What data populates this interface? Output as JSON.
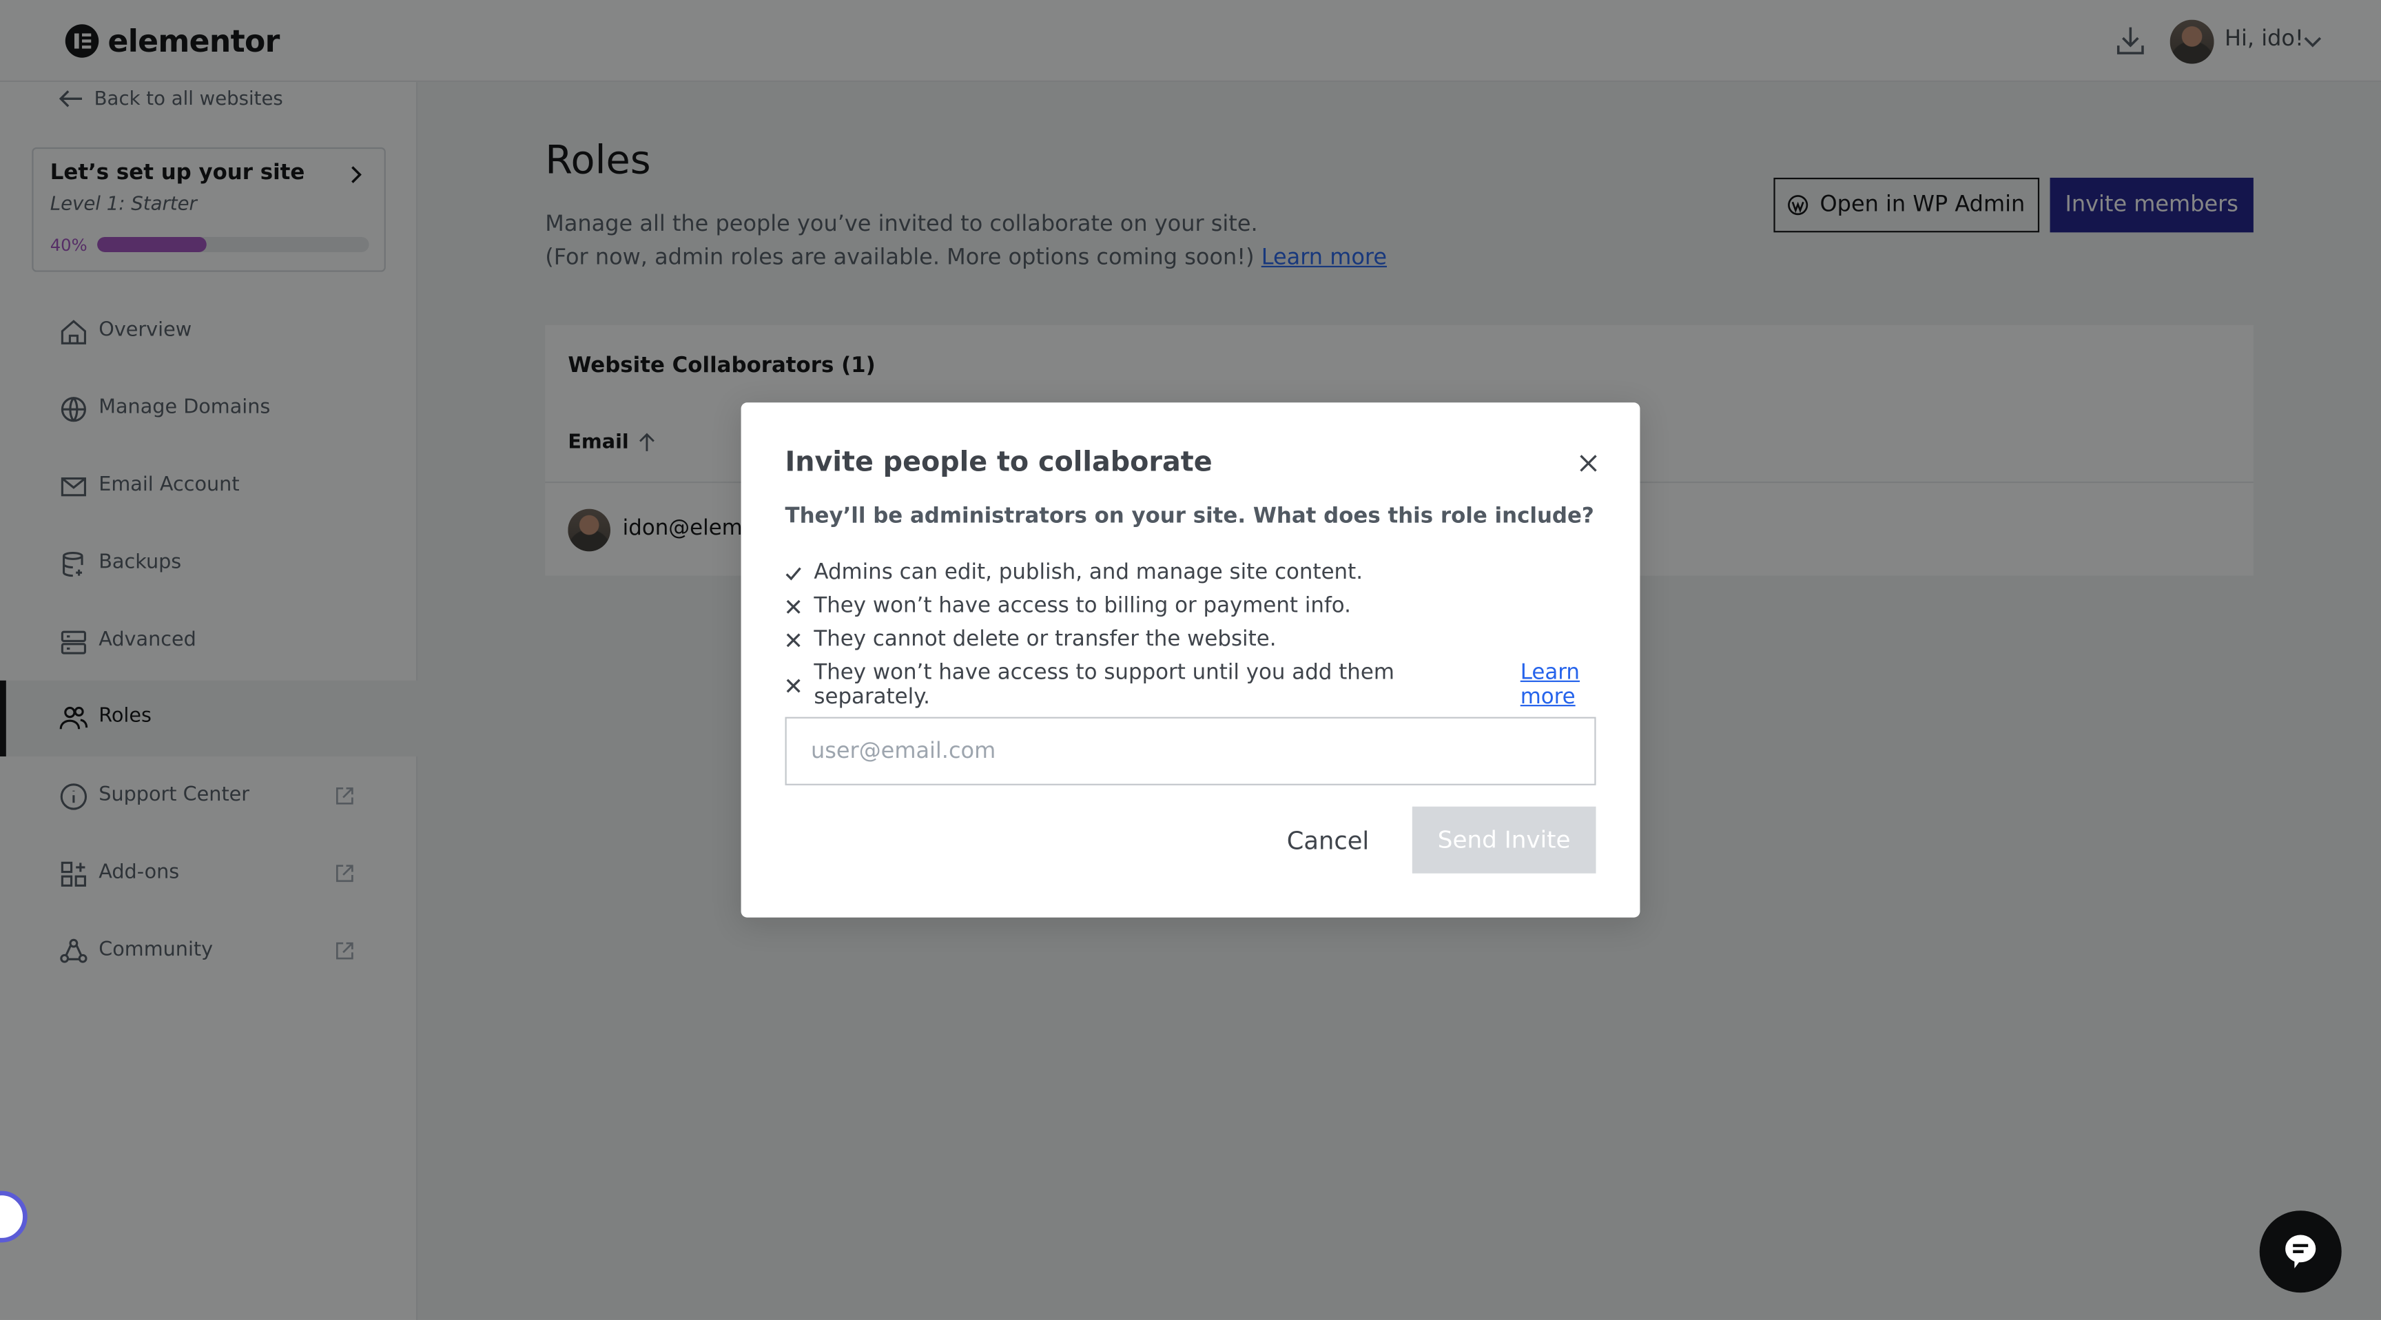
{
  "header": {
    "logo_text": "elementor",
    "greeting": "Hi, ido!"
  },
  "sidebar": {
    "back_label": "Back to all websites",
    "setup": {
      "title": "Let’s set up your site",
      "level": "Level 1: Starter",
      "progress_label": "40%",
      "progress_fraction": 0.4
    },
    "items": [
      {
        "label": "Overview",
        "icon": "home-icon",
        "external": false,
        "active": false
      },
      {
        "label": "Manage Domains",
        "icon": "globe-icon",
        "external": false,
        "active": false
      },
      {
        "label": "Email Account",
        "icon": "mail-icon",
        "external": false,
        "active": false
      },
      {
        "label": "Backups",
        "icon": "database-icon",
        "external": false,
        "active": false
      },
      {
        "label": "Advanced",
        "icon": "server-icon",
        "external": false,
        "active": false
      },
      {
        "label": "Roles",
        "icon": "users-icon",
        "external": false,
        "active": true
      },
      {
        "label": "Support Center",
        "icon": "info-icon",
        "external": true,
        "active": false
      },
      {
        "label": "Add-ons",
        "icon": "grid-plus-icon",
        "external": true,
        "active": false
      },
      {
        "label": "Community",
        "icon": "community-icon",
        "external": true,
        "active": false
      }
    ]
  },
  "main": {
    "title": "Roles",
    "desc_line1": "Manage all the people you’ve invited to collaborate on your site.",
    "desc_line2": "(For now, admin roles are available. More options coming soon!)",
    "learn_more": "Learn more",
    "open_wp_admin": "Open in WP Admin",
    "invite_members": "Invite members",
    "table": {
      "title": "Website Collaborators (1)",
      "column_email": "Email",
      "rows": [
        {
          "email": "idon@eleme"
        }
      ]
    }
  },
  "modal": {
    "title": "Invite people to collaborate",
    "subtitle": "They’ll be administrators on your site. What does this role include?",
    "rules": [
      {
        "type": "check",
        "text": "Admins can edit, publish, and manage site content."
      },
      {
        "type": "cross",
        "text": "They won’t have access to billing or payment info."
      },
      {
        "type": "cross",
        "text": "They cannot delete or transfer the website."
      },
      {
        "type": "cross",
        "text": "They won’t have access to support until you add them separately."
      }
    ],
    "rule_link": "Learn more",
    "email_value": "",
    "email_placeholder": "user@email.com",
    "cancel_label": "Cancel",
    "send_label": "Send Invite"
  },
  "colors": {
    "accent": "#1d1d8a",
    "progress": "#a04fbf",
    "link": "#2563eb",
    "disabled_button": "#d5d8dc"
  }
}
